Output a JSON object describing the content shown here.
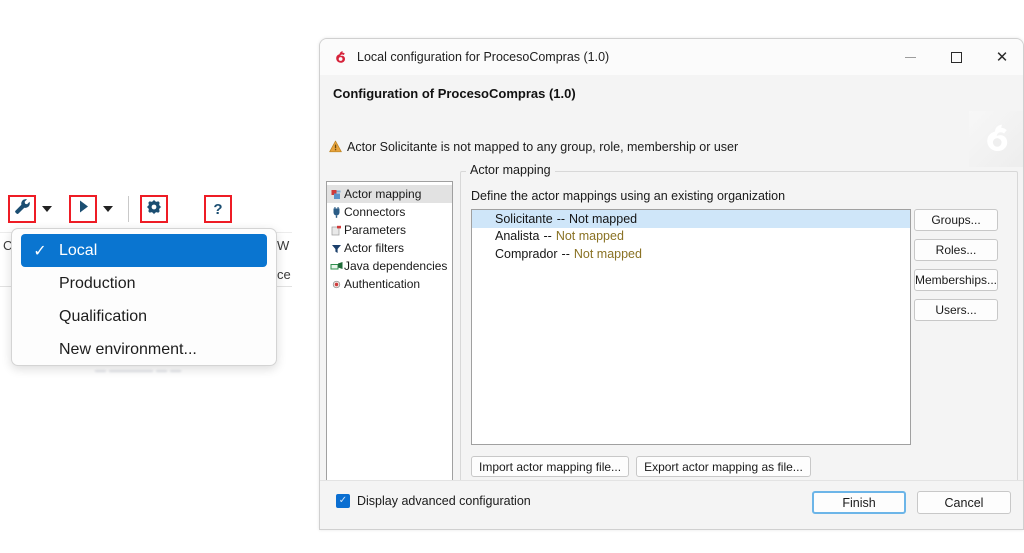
{
  "toolbar": {
    "items": [
      {
        "name": "configure-icon",
        "icon": "wrench-icon",
        "highlighted": true
      },
      {
        "name": "configure-dropdown",
        "icon": "caret-down-icon",
        "highlighted": false
      },
      {
        "name": "run-icon",
        "icon": "play-icon",
        "highlighted": true
      },
      {
        "name": "run-dropdown",
        "icon": "caret-down-icon",
        "highlighted": false
      },
      {
        "name": "preferences-icon",
        "icon": "gear-icon",
        "highlighted": true
      },
      {
        "name": "help-icon",
        "icon": "question-mark-icon",
        "highlighted": true
      }
    ],
    "highlight_color": "#ee1c25",
    "icon_color": "#1b4e72"
  },
  "background": {
    "left_fragment": "C",
    "right_fragment": "W",
    "right_fragment2": "ce",
    "blurred_fragment": "—  ————  —   —"
  },
  "env_menu": {
    "check_glyph": "✓",
    "items": [
      {
        "label": "Local",
        "selected": true
      },
      {
        "label": "Production",
        "selected": false
      },
      {
        "label": "Qualification",
        "selected": false
      },
      {
        "label": "New environment...",
        "selected": false
      }
    ],
    "selected_bg": "#0a75d0"
  },
  "dialog": {
    "titlebar": {
      "title": "Local configuration for ProcesoCompras (1.0)",
      "logo": "bonita-logo-icon",
      "minimize": "minimize-icon",
      "maximize": "maximize-icon",
      "close": "close-icon"
    },
    "heading": "Configuration of ProcesoCompras (1.0)",
    "warning": {
      "icon": "warning-triangle-icon",
      "text": "Actor Solicitante is not mapped to any group, role, membership or user",
      "color": "#e8a33d"
    },
    "watermark": "bonita-logo-watermark",
    "sidebar": {
      "items": [
        {
          "label": "Actor mapping",
          "icon": "actor-mapping-icon",
          "active": true
        },
        {
          "label": "Connectors",
          "icon": "connector-plug-icon",
          "active": false
        },
        {
          "label": "Parameters",
          "icon": "parameters-icon",
          "active": false
        },
        {
          "label": "Actor filters",
          "icon": "filter-funnel-icon",
          "active": false
        },
        {
          "label": "Java dependencies",
          "icon": "java-dependencies-icon",
          "active": false
        },
        {
          "label": "Authentication",
          "icon": "authentication-icon",
          "active": false
        }
      ]
    },
    "content": {
      "group_title": "Actor mapping",
      "description": "Define the actor mappings using an existing organization",
      "not_mapped_label": "Not mapped",
      "separator": "--",
      "rows": [
        {
          "actor": "Solicitante",
          "separator": "--",
          "state": "Not mapped",
          "selected": true
        },
        {
          "actor": "Analista",
          "separator": "--",
          "state": "Not mapped",
          "selected": false
        },
        {
          "actor": "Comprador",
          "separator": "--",
          "state": "Not mapped",
          "selected": false
        }
      ],
      "side_buttons": [
        {
          "label": "Groups..."
        },
        {
          "label": "Roles..."
        },
        {
          "label": "Memberships..."
        },
        {
          "label": "Users..."
        }
      ],
      "io_buttons": [
        {
          "label": "Import actor mapping file..."
        },
        {
          "label": "Export actor mapping as file..."
        }
      ],
      "selection_color": "#cfe6f9",
      "not_mapped_color": "#8a7224"
    },
    "footer": {
      "checkbox_label": "Display advanced configuration",
      "checkbox_checked": true,
      "check_glyph": "✓",
      "finish_label": "Finish",
      "cancel_label": "Cancel",
      "focus_color": "#6cb5e8"
    }
  }
}
